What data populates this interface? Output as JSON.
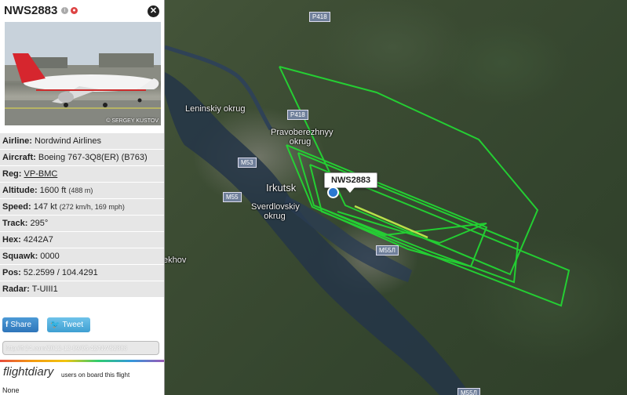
{
  "flight": {
    "callsign": "NWS2883",
    "photo_credit": "© SERGEY KUSTOV",
    "photo_livery": "nordwind"
  },
  "details": [
    {
      "label": "Airline:",
      "value": "Nordwind Airlines",
      "sub": ""
    },
    {
      "label": "Aircraft:",
      "value": "Boeing 767-3Q8(ER) (B763)",
      "sub": ""
    },
    {
      "label": "Reg:",
      "value": "VP-BMC",
      "sub": "",
      "link": true
    },
    {
      "label": "Altitude:",
      "value": "1600 ft",
      "sub": "(488 m)"
    },
    {
      "label": "Speed:",
      "value": "147 kt",
      "sub": "(272 km/h, 169 mph)"
    },
    {
      "label": "Track:",
      "value": "295°",
      "sub": ""
    },
    {
      "label": "Hex:",
      "value": "4242A7",
      "sub": ""
    },
    {
      "label": "Squawk:",
      "value": "0000",
      "sub": ""
    },
    {
      "label": "Pos:",
      "value": "52.2599 / 104.4291",
      "sub": ""
    },
    {
      "label": "Radar:",
      "value": "T-UIII1",
      "sub": ""
    }
  ],
  "social": {
    "share_label": "Share",
    "tweet_label": "Tweet",
    "share_icon": "f",
    "tweet_icon": "bird-icon"
  },
  "share_url": "http://fr24.com/2012-12-09/05:42/NWS2883",
  "flightdiary": {
    "logo": "flightdiary",
    "text": "users on board this flight",
    "users": "None"
  },
  "map": {
    "callout": "NWS2883",
    "labels": {
      "leninskiy": "Leninskiy okrug",
      "pravoberezhnyy": "Pravoberezhnyy okrug",
      "irkutsk": "Irkutsk",
      "sverdlovskiy": "Sverdlovskiy okrug",
      "khov": "ekhov"
    },
    "roads": {
      "p418a": "P418",
      "p418b": "P418",
      "m53": "M53",
      "m55a": "M55",
      "m55b": "M55Л",
      "m55c": "M55Л"
    }
  },
  "colors": {
    "track": "#22dd33",
    "plane": "#d42020",
    "panel_row": "#e6e6e6",
    "share": "#2f75ba"
  }
}
